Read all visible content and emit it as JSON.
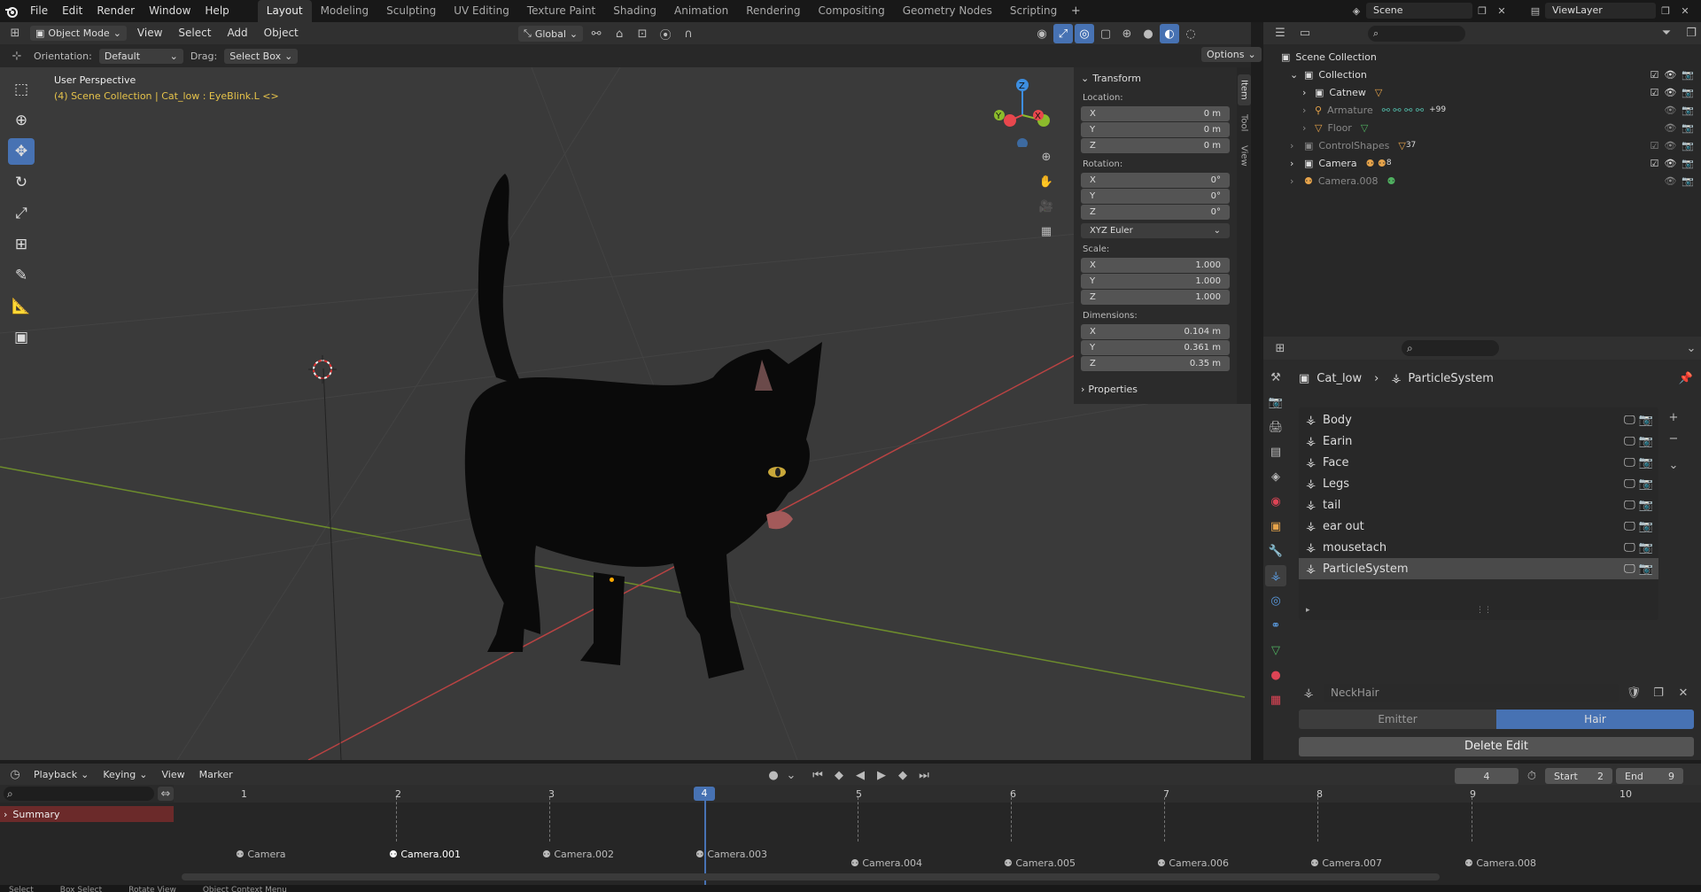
{
  "menu": [
    "File",
    "Edit",
    "Render",
    "Window",
    "Help"
  ],
  "workspaces": [
    "Layout",
    "Modeling",
    "Sculpting",
    "UV Editing",
    "Texture Paint",
    "Shading",
    "Animation",
    "Rendering",
    "Compositing",
    "Geometry Nodes",
    "Scripting"
  ],
  "active_workspace": "Layout",
  "scene_name": "Scene",
  "view_layer": "ViewLayer",
  "viewport": {
    "mode": "Object Mode",
    "menus": [
      "View",
      "Select",
      "Add",
      "Object"
    ],
    "transform_orientation": "Global",
    "orientation_label": "Orientation:",
    "orientation_value": "Default",
    "drag_label": "Drag:",
    "drag_value": "Select Box",
    "options_label": "Options",
    "perspective_text": "User Perspective",
    "context_text": "(4) Scene Collection | Cat_low : EyeBlink.L <>"
  },
  "npanel": {
    "section": "Transform",
    "location_label": "Location:",
    "location": [
      {
        "axis": "X",
        "value": "0 m"
      },
      {
        "axis": "Y",
        "value": "0 m"
      },
      {
        "axis": "Z",
        "value": "0 m"
      }
    ],
    "rotation_label": "Rotation:",
    "rotation": [
      {
        "axis": "X",
        "value": "0°"
      },
      {
        "axis": "Y",
        "value": "0°"
      },
      {
        "axis": "Z",
        "value": "0°"
      }
    ],
    "rotation_mode": "XYZ Euler",
    "scale_label": "Scale:",
    "scale": [
      {
        "axis": "X",
        "value": "1.000"
      },
      {
        "axis": "Y",
        "value": "1.000"
      },
      {
        "axis": "Z",
        "value": "1.000"
      }
    ],
    "dimensions_label": "Dimensions:",
    "dimensions": [
      {
        "axis": "X",
        "value": "0.104 m"
      },
      {
        "axis": "Y",
        "value": "0.361 m"
      },
      {
        "axis": "Z",
        "value": "0.35 m"
      }
    ],
    "properties_label": "Properties",
    "tabs": [
      "Item",
      "Tool",
      "View"
    ]
  },
  "outliner": {
    "root": "Scene Collection",
    "items": [
      {
        "name": "Collection",
        "level": 1,
        "badge": ""
      },
      {
        "name": "Catnew",
        "level": 2,
        "badge": ""
      },
      {
        "name": "Armature",
        "level": 2,
        "badge": "+99"
      },
      {
        "name": "Floor",
        "level": 2,
        "badge": ""
      },
      {
        "name": "ControlShapes",
        "level": 1,
        "badge": "37"
      },
      {
        "name": "Camera",
        "level": 1,
        "badge": "8"
      },
      {
        "name": "Camera.008",
        "level": 1,
        "badge": ""
      }
    ]
  },
  "properties": {
    "breadcrumb_object": "Cat_low",
    "breadcrumb_item": "ParticleSystem",
    "particle_systems": [
      "Body",
      "Earin",
      "Face",
      "Legs",
      "tail",
      "ear out",
      "mousetach",
      "ParticleSystem"
    ],
    "selected_system": "ParticleSystem",
    "settings_name": "NeckHair",
    "emitter_label": "Emitter",
    "hair_label": "Hair",
    "delete_edit_label": "Delete Edit"
  },
  "timeline": {
    "menus": [
      "Playback",
      "Keying",
      "View",
      "Marker"
    ],
    "current_frame": "4",
    "start_label": "Start",
    "start": "2",
    "end_label": "End",
    "end": "9",
    "frame_numbers": [
      "1",
      "2",
      "3",
      "4",
      "5",
      "6",
      "7",
      "8",
      "9",
      "10"
    ],
    "summary_label": "Summary",
    "markers": [
      "Camera",
      "Camera.001",
      "Camera.002",
      "Camera.003",
      "Camera.004",
      "Camera.005",
      "Camera.006",
      "Camera.007",
      "Camera.008"
    ]
  },
  "statusbar": [
    "Select",
    "Box Select",
    "Rotate View",
    "Object Context Menu"
  ],
  "colors": {
    "accent": "#4772b3",
    "x_axis": "#e8474d",
    "y_axis": "#8cbb2c",
    "z_axis": "#3d8ee0",
    "summary": "#6b2a2a"
  }
}
